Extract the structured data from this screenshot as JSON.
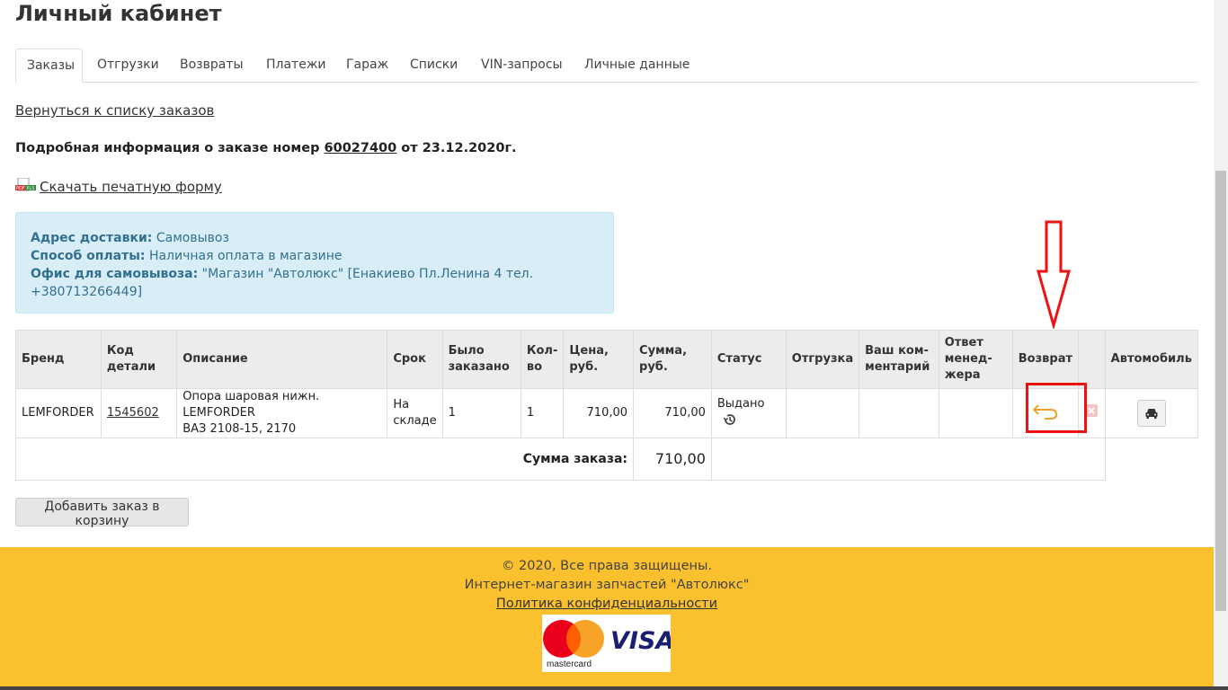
{
  "page_title": "Личный кабинет",
  "tabs": [
    {
      "label": "Заказы",
      "active": true
    },
    {
      "label": "Отгрузки"
    },
    {
      "label": "Возвраты"
    },
    {
      "label": "Платежи"
    },
    {
      "label": "Гараж"
    },
    {
      "label": "Списки"
    },
    {
      "label": "VIN-запросы"
    },
    {
      "label": "Личные данные"
    }
  ],
  "back_link": "Вернуться к списку заказов",
  "order": {
    "title_prefix": "Подробная информация о заказе номер",
    "number": "60027400",
    "date_text": "от 23.12.2020г."
  },
  "download": {
    "icon_text": "PDF XLS",
    "label": "Скачать печатную форму"
  },
  "info": {
    "delivery_label": "Адрес доставки:",
    "delivery_value": "Самовывоз",
    "payment_label": "Способ оплаты:",
    "payment_value": "Наличная оплата в магазине",
    "office_label": "Офис для самовывоза:",
    "office_value": "\"Магазин \"Автолюкс\" [Енакиево Пл.Ленина 4 тел. +380713266449]"
  },
  "table": {
    "headers": {
      "brand": "Бренд",
      "code": "Код детали",
      "desc": "Описание",
      "term": "Срок",
      "ordered_1": "Было",
      "ordered_2": "заказано",
      "qty_1": "Кол-",
      "qty_2": "во",
      "price": "Цена, руб.",
      "sum": "Сумма, руб.",
      "status": "Статус",
      "shipment": "Отгрузка",
      "comment_1": "Ваш ком-",
      "comment_2": "ментарий",
      "manager_1": "Ответ",
      "manager_2": "менед-",
      "manager_3": "жера",
      "return": "Возврат",
      "car": "Автомобиль"
    },
    "row": {
      "brand": "LEMFORDER",
      "code": "1545602",
      "desc_1": "Опора шаровая нижн. LEMFORDER",
      "desc_2": "ВАЗ 2108-15, 2170",
      "term_1": "На",
      "term_2": "складе",
      "ordered": "1",
      "qty": "1",
      "price": "710,00",
      "sum": "710,00",
      "status": "Выдано"
    },
    "total_label": "Сумма заказа:",
    "total_value": "710,00"
  },
  "add_to_cart": "Добавить заказ в корзину",
  "footer": {
    "copyright": "© 2020, Все права защищены.",
    "shop": "Интернет-магазин запчастей \"Автолюкс\"",
    "privacy": "Политика конфиденциальности",
    "mastercard": "mastercard",
    "visa": "VISA"
  },
  "colors": {
    "footer_bg": "#fbc02d",
    "info_bg": "#d9edf7",
    "highlight": "#e11111",
    "return_icon": "#f0a030"
  }
}
